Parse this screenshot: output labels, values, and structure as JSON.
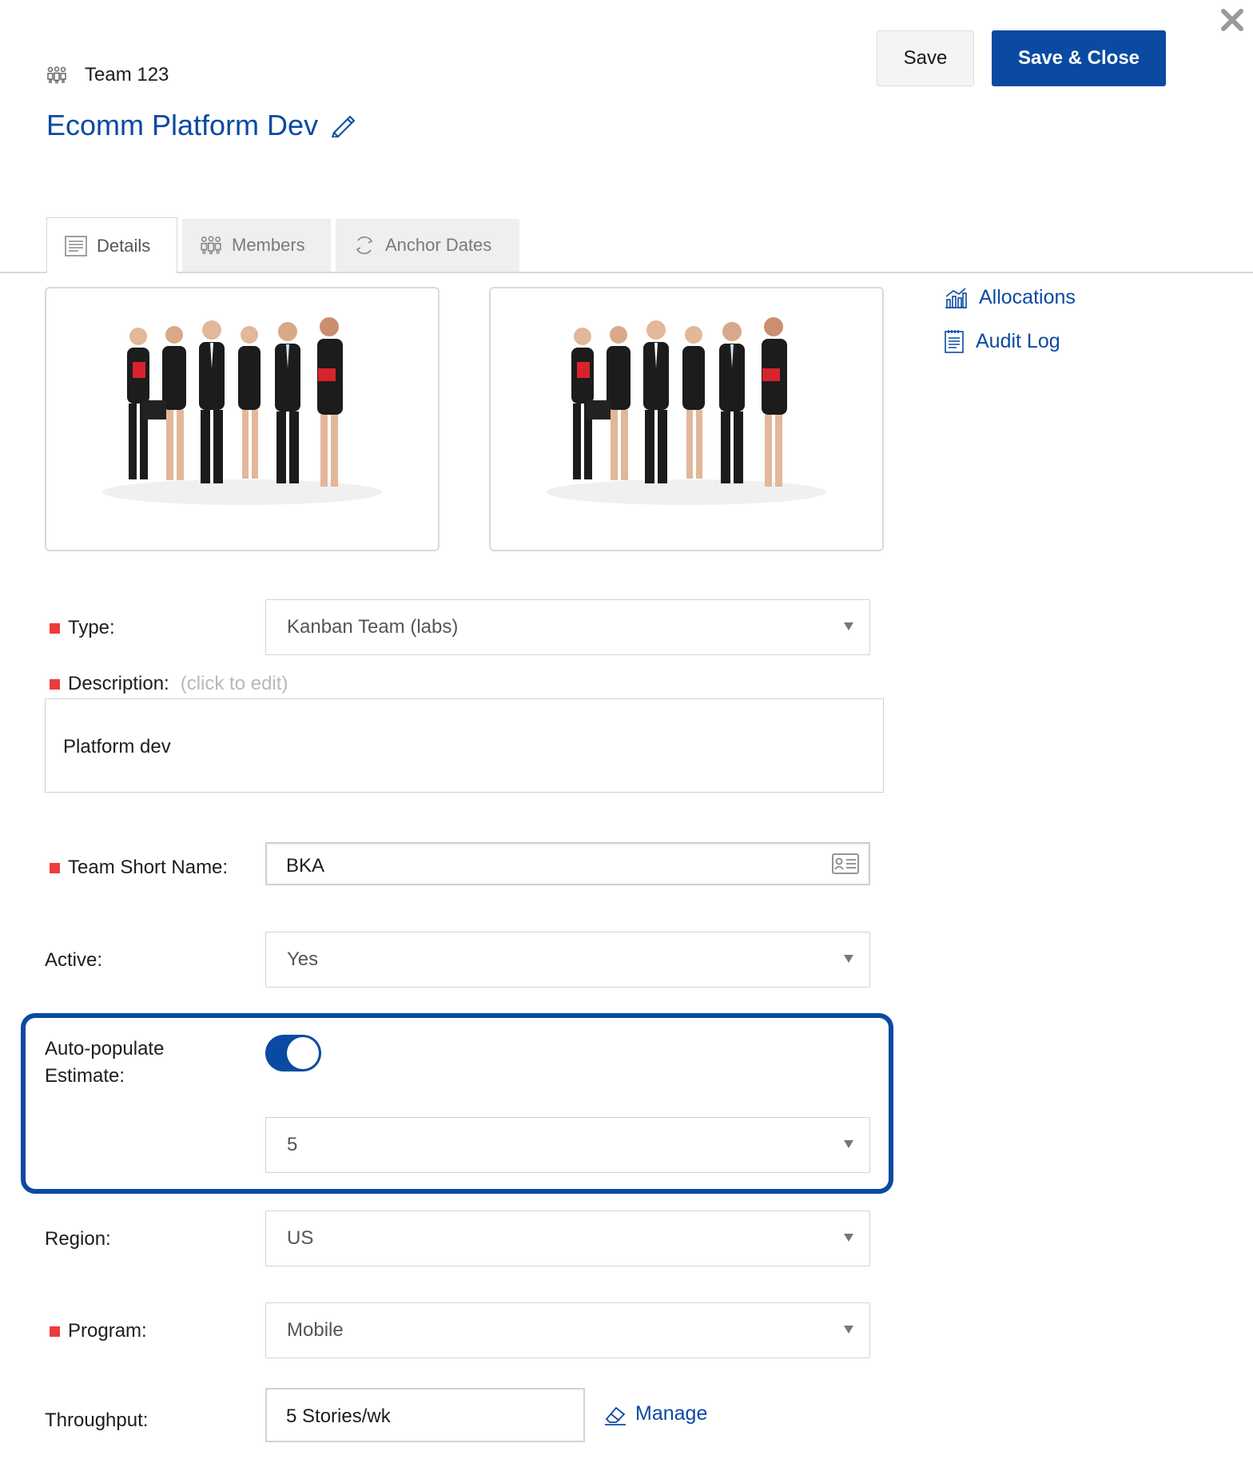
{
  "header": {
    "team_label": "Team 123",
    "title": "Ecomm Platform Dev",
    "save_label": "Save",
    "save_close_label": "Save & Close"
  },
  "tabs": [
    {
      "label": "Details",
      "icon": "document-icon",
      "active": true
    },
    {
      "label": "Members",
      "icon": "people-icon",
      "active": false
    },
    {
      "label": "Anchor Dates",
      "icon": "refresh-icon",
      "active": false
    }
  ],
  "side_links": [
    {
      "label": "Allocations",
      "icon": "chart-icon"
    },
    {
      "label": "Audit Log",
      "icon": "log-icon"
    }
  ],
  "form": {
    "type": {
      "label": "Type:",
      "value": "Kanban Team (labs)",
      "required": true
    },
    "description": {
      "label": "Description:",
      "hint": "(click to edit)",
      "value": "Platform dev",
      "required": true
    },
    "short_name": {
      "label": "Team Short Name:",
      "value": "BKA",
      "required": true
    },
    "active": {
      "label": "Active:",
      "value": "Yes"
    },
    "auto_populate": {
      "label_line1": "Auto-populate",
      "label_line2": "Estimate:",
      "enabled": true,
      "value": "5"
    },
    "region": {
      "label": "Region:",
      "value": "US"
    },
    "program": {
      "label": "Program:",
      "value": "Mobile",
      "required": true
    },
    "throughput": {
      "label": "Throughput:",
      "value": "5 Stories/wk",
      "manage_label": "Manage"
    }
  },
  "colors": {
    "accent": "#0b4aa2",
    "required_marker": "#ef3b3b"
  }
}
